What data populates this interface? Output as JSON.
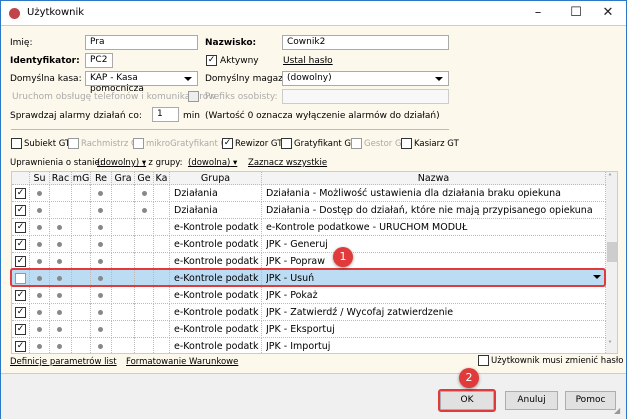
{
  "window": {
    "title": "Użytkownik"
  },
  "form": {
    "imie_label": "Imię:",
    "imie_value": "Pra",
    "nazwisko_label": "Nazwisko:",
    "nazwisko_value": "Cownik2",
    "identyfikator_label": "Identyfikator:",
    "identyfikator_value": "PC2",
    "aktywny_label": "Aktywny",
    "aktywny_checked": true,
    "ustal_haslo": "Ustal hasło",
    "kasa_label": "Domyślna kasa:",
    "kasa_value": "KAP - Kasa pomocnicza",
    "magazyn_label": "Domyślny magazyn:",
    "magazyn_value": "(dowolny)",
    "telefony_label": "Uruchom obsługę telefonów i komunikatorów",
    "prefiks_label": "Prefiks osobisty:",
    "prefiks_value": "",
    "alarmy_label": "Sprawdzaj alarmy działań co:",
    "alarmy_value": "1",
    "alarmy_unit": "min",
    "alarmy_note": "(Wartość 0 oznacza wyłączenie alarmów do działań)"
  },
  "programs": [
    {
      "label": "Subiekt GT",
      "checked": false,
      "enabled": true
    },
    {
      "label": "Rachmistrz GT",
      "checked": false,
      "enabled": false
    },
    {
      "label": "mikroGratyfikant GT",
      "checked": false,
      "enabled": false
    },
    {
      "label": "Rewizor GT",
      "checked": true,
      "enabled": true
    },
    {
      "label": "Gratyfikant GT",
      "checked": false,
      "enabled": true
    },
    {
      "label": "Gestor GT",
      "checked": false,
      "enabled": false
    },
    {
      "label": "Kasiarz GT",
      "checked": false,
      "enabled": true
    }
  ],
  "filters": {
    "stan_label": "Uprawnienia o stanie:",
    "stan_value": "(dowolny)",
    "grupa_label": ", z grupy:",
    "grupa_value": "(dowolna)",
    "select_all": "Zaznacz wszystkie"
  },
  "table": {
    "columns": [
      "",
      "Su",
      "Rac",
      "mG",
      "Re",
      "Gra",
      "Ge",
      "Ka",
      "Grupa",
      "Nazwa"
    ],
    "rows": [
      {
        "checked": true,
        "dots": [
          1,
          0,
          0,
          1,
          0,
          1,
          0
        ],
        "grupa": "Działania",
        "nazwa": "Działania - Możliwość ustawienia dla działania braku opiekuna"
      },
      {
        "checked": true,
        "dots": [
          1,
          0,
          0,
          1,
          0,
          1,
          0
        ],
        "grupa": "Działania",
        "nazwa": "Działania - Dostęp do działań, które nie mają przypisanego opiekuna"
      },
      {
        "checked": true,
        "dots": [
          1,
          1,
          0,
          1,
          0,
          0,
          0
        ],
        "grupa": "e-Kontrole podatk",
        "nazwa": "e-Kontrole podatkowe - URUCHOM MODUŁ"
      },
      {
        "checked": true,
        "dots": [
          1,
          1,
          0,
          1,
          0,
          0,
          0
        ],
        "grupa": "e-Kontrole podatk",
        "nazwa": "JPK - Generuj"
      },
      {
        "checked": true,
        "dots": [
          1,
          1,
          0,
          1,
          0,
          0,
          0
        ],
        "grupa": "e-Kontrole podatk",
        "nazwa": "JPK - Popraw"
      },
      {
        "checked": false,
        "selected": true,
        "dots": [
          1,
          1,
          0,
          1,
          0,
          0,
          0
        ],
        "grupa": "e-Kontrole podatk",
        "nazwa": "JPK - Usuń"
      },
      {
        "checked": true,
        "dots": [
          1,
          1,
          0,
          1,
          0,
          0,
          0
        ],
        "grupa": "e-Kontrole podatk",
        "nazwa": "JPK - Pokaż"
      },
      {
        "checked": true,
        "dots": [
          1,
          1,
          0,
          1,
          0,
          0,
          0
        ],
        "grupa": "e-Kontrole podatk",
        "nazwa": "JPK - Zatwierdź / Wycofaj zatwierdzenie"
      },
      {
        "checked": true,
        "dots": [
          1,
          1,
          0,
          1,
          0,
          0,
          0
        ],
        "grupa": "e-Kontrole podatk",
        "nazwa": "JPK - Eksportuj"
      },
      {
        "checked": true,
        "dots": [
          1,
          1,
          0,
          1,
          0,
          0,
          0
        ],
        "grupa": "e-Kontrole podatk",
        "nazwa": "JPK - Importuj"
      }
    ]
  },
  "links": {
    "definicje": "Definicje parametrów list",
    "formatowanie": "Formatowanie Warunkowe"
  },
  "must_change_password": {
    "label": "Użytkownik musi zmienić hasło",
    "checked": false
  },
  "buttons": {
    "ok": "OK",
    "cancel": "Anuluj",
    "help": "Pomoc"
  },
  "annotations": {
    "step1": "1",
    "step2": "2",
    "color": "#e03a3a"
  }
}
